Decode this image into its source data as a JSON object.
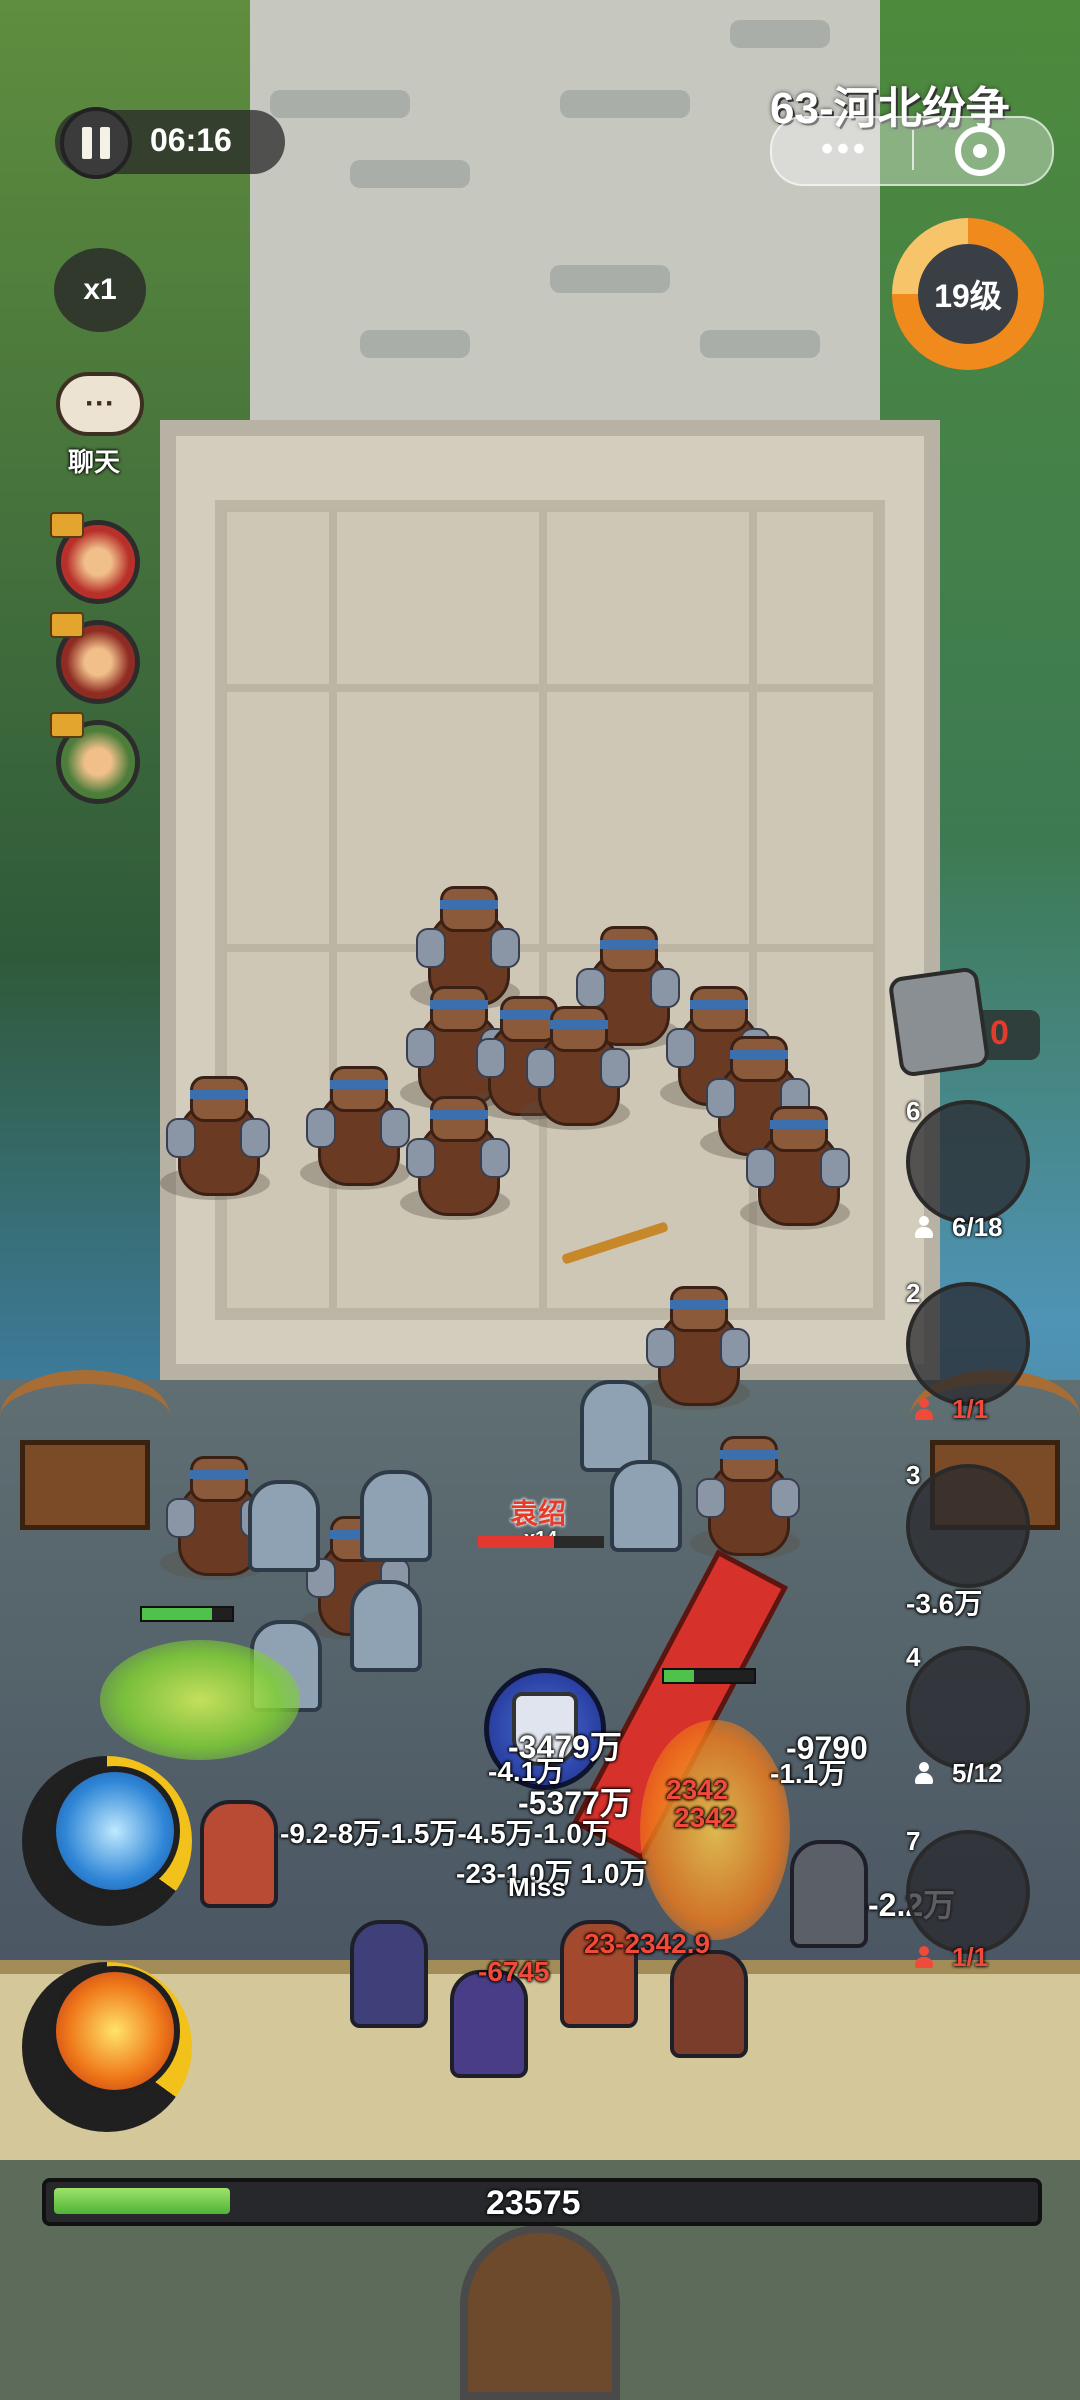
{
  "hud": {
    "timer": "06:16",
    "speed": "x1",
    "chat_label": "聊天",
    "chat_icon": "···",
    "stage_title": "63-河北纷争",
    "more_label": "•••",
    "level": "19级",
    "level_progress": 0.75,
    "token_count": "0",
    "progress_value": "23575",
    "progress_fraction": 0.18
  },
  "heroes": [
    {
      "name": "hero-avatar-1",
      "color": "#b8302a"
    },
    {
      "name": "hero-avatar-2",
      "color": "#8e2b22"
    },
    {
      "name": "hero-avatar-3",
      "color": "#4d7d3a"
    }
  ],
  "unit_slots": [
    {
      "num": "6",
      "count": "6/18",
      "count_color": "#ffffff",
      "icon_color": "#ffffff"
    },
    {
      "num": "2",
      "count": "1/1",
      "count_color": "#f04a3a",
      "icon_color": "#f04a3a"
    },
    {
      "num": "3",
      "count": "",
      "count_color": "#ffffff",
      "icon_color": "#ffffff"
    },
    {
      "num": "4",
      "count": "5/12",
      "count_color": "#ffffff",
      "icon_color": "#ffffff"
    },
    {
      "num": "7",
      "count": "1/1",
      "count_color": "#f04a3a",
      "icon_color": "#f04a3a"
    }
  ],
  "boss": {
    "name": "袁绍",
    "combo": "x14",
    "hp_fraction": 0.6
  },
  "combat_text": {
    "t1": "-3.6万",
    "t2": "-3479万",
    "t3": "-9790",
    "t4": "-4.1万",
    "t5": "-1.1万",
    "t6": "-5377万",
    "t7": "2342",
    "t8": "-9.2-8万-1.5万-4.5万-1.0万",
    "t9": "2342",
    "t10": "-23-1.0万 1.0万",
    "t11": "Miss",
    "t12": "-2.2万",
    "t13": "23-2342.9",
    "t14": "-6745"
  },
  "colors": {
    "accent": "#f08a1c",
    "progress": "#4fb336",
    "damage_red": "#f04a3a"
  }
}
